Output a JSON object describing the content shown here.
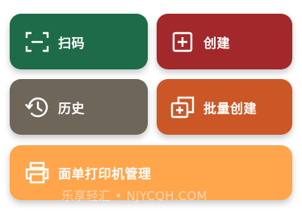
{
  "tiles": {
    "scan": {
      "label": "扫码",
      "color": "#1e6b49",
      "icon": "scan-icon"
    },
    "create": {
      "label": "创建",
      "color": "#a3282b",
      "icon": "add-box-icon"
    },
    "history": {
      "label": "历史",
      "color": "#6d6659",
      "icon": "history-icon"
    },
    "batch": {
      "label": "批量创建",
      "color": "#cc5726",
      "icon": "batch-add-icon"
    },
    "print": {
      "label": "面单打印机管理",
      "color": "#ffa54c",
      "icon": "printer-icon"
    }
  },
  "watermark": "乐享轻汇 • NJYCQH.COM"
}
